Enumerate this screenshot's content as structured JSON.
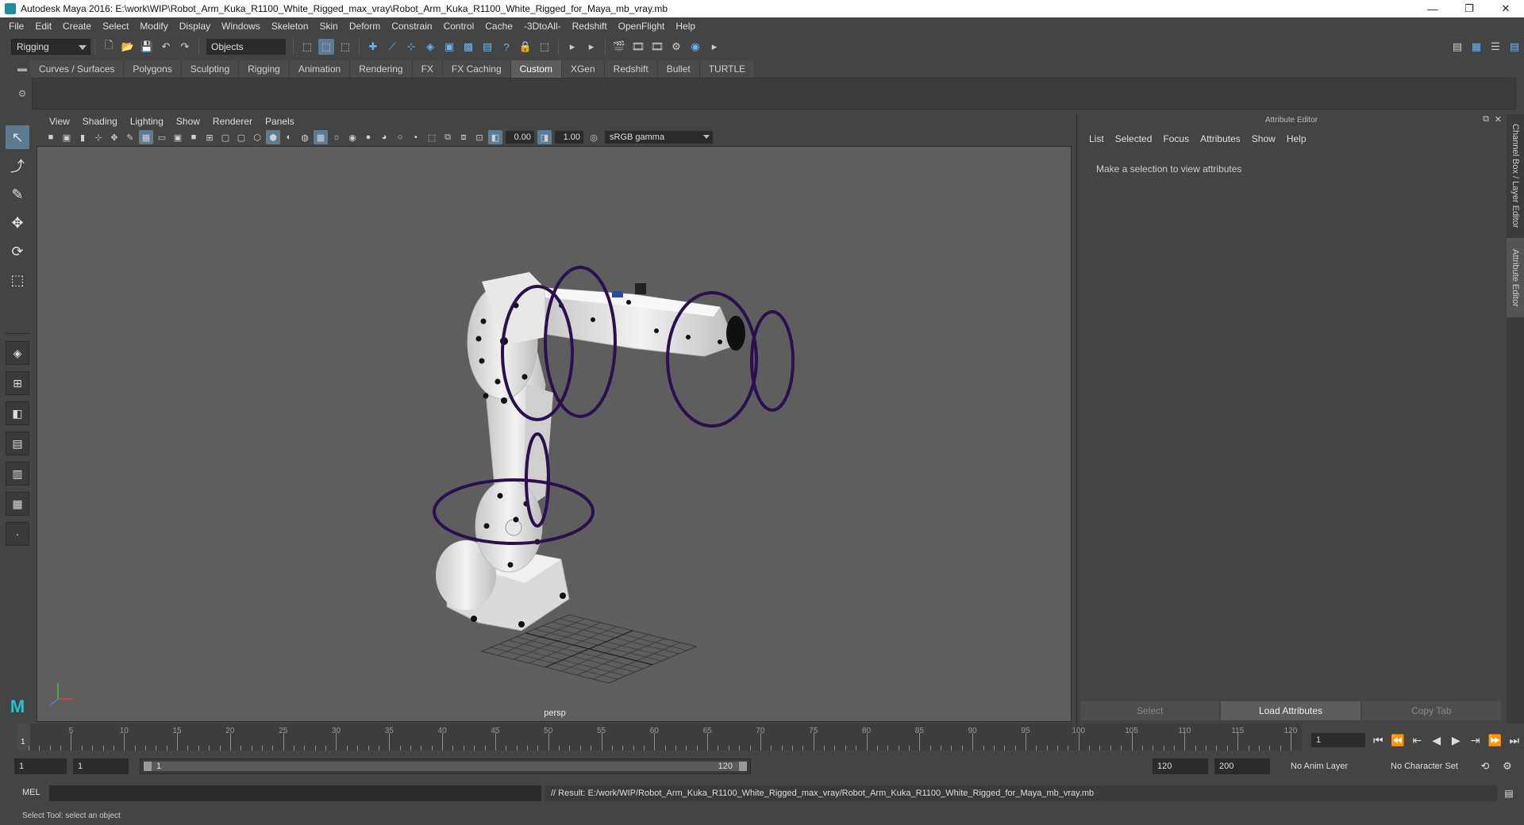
{
  "window": {
    "title": "Autodesk Maya 2016: E:\\work\\WIP\\Robot_Arm_Kuka_R1100_White_Rigged_max_vray\\Robot_Arm_Kuka_R1100_White_Rigged_for_Maya_mb_vray.mb",
    "minimize": "—",
    "maximize": "❐",
    "close": "✕"
  },
  "menubar": [
    "File",
    "Edit",
    "Create",
    "Select",
    "Modify",
    "Display",
    "Windows",
    "Skeleton",
    "Skin",
    "Deform",
    "Constrain",
    "Control",
    "Cache",
    "-3DtoAll-",
    "Redshift",
    "OpenFlight",
    "Help"
  ],
  "statusline": {
    "mode": "Rigging",
    "selection_mask": "Objects"
  },
  "shelf": {
    "tabs": [
      "Curves / Surfaces",
      "Polygons",
      "Sculpting",
      "Rigging",
      "Animation",
      "Rendering",
      "FX",
      "FX Caching",
      "Custom",
      "XGen",
      "Redshift",
      "Bullet",
      "TURTLE"
    ],
    "active_tab": "Custom"
  },
  "viewport": {
    "menus": [
      "View",
      "Shading",
      "Lighting",
      "Show",
      "Renderer",
      "Panels"
    ],
    "exposure": "0.00",
    "gamma": "1.00",
    "color_space": "sRGB gamma",
    "camera": "persp"
  },
  "attribute_editor": {
    "title": "Attribute Editor",
    "menus": [
      "List",
      "Selected",
      "Focus",
      "Attributes",
      "Show",
      "Help"
    ],
    "message": "Make a selection to view attributes",
    "buttons": {
      "select": "Select",
      "load": "Load Attributes",
      "copy_tab": "Copy Tab"
    },
    "side_tabs": [
      "Channel Box / Layer Editor",
      "Attribute Editor"
    ]
  },
  "timeslider": {
    "start": 1,
    "end": 120,
    "current": "1",
    "ticks": [
      5,
      10,
      15,
      20,
      25,
      30,
      35,
      40,
      45,
      50,
      55,
      60,
      65,
      70,
      75,
      80,
      85,
      90,
      95,
      100,
      105,
      110,
      115,
      120
    ],
    "current_frame_field": "1"
  },
  "range": {
    "anim_start": "1",
    "playback_start": "1",
    "range_start_label": "1",
    "range_end_label": "120",
    "playback_end": "120",
    "anim_end": "200",
    "anim_layer": "No Anim Layer",
    "character_set": "No Character Set"
  },
  "command_line": {
    "label": "MEL",
    "result": "// Result: E:/work/WIP/Robot_Arm_Kuka_R1100_White_Rigged_max_vray/Robot_Arm_Kuka_R1100_White_Rigged_for_Maya_mb_vray.mb"
  },
  "help_line": "Select Tool: select an object",
  "colors": {
    "accent": "#5d7c94",
    "control_curve": "#2a1050",
    "robot_body": "#e6e6e6"
  }
}
